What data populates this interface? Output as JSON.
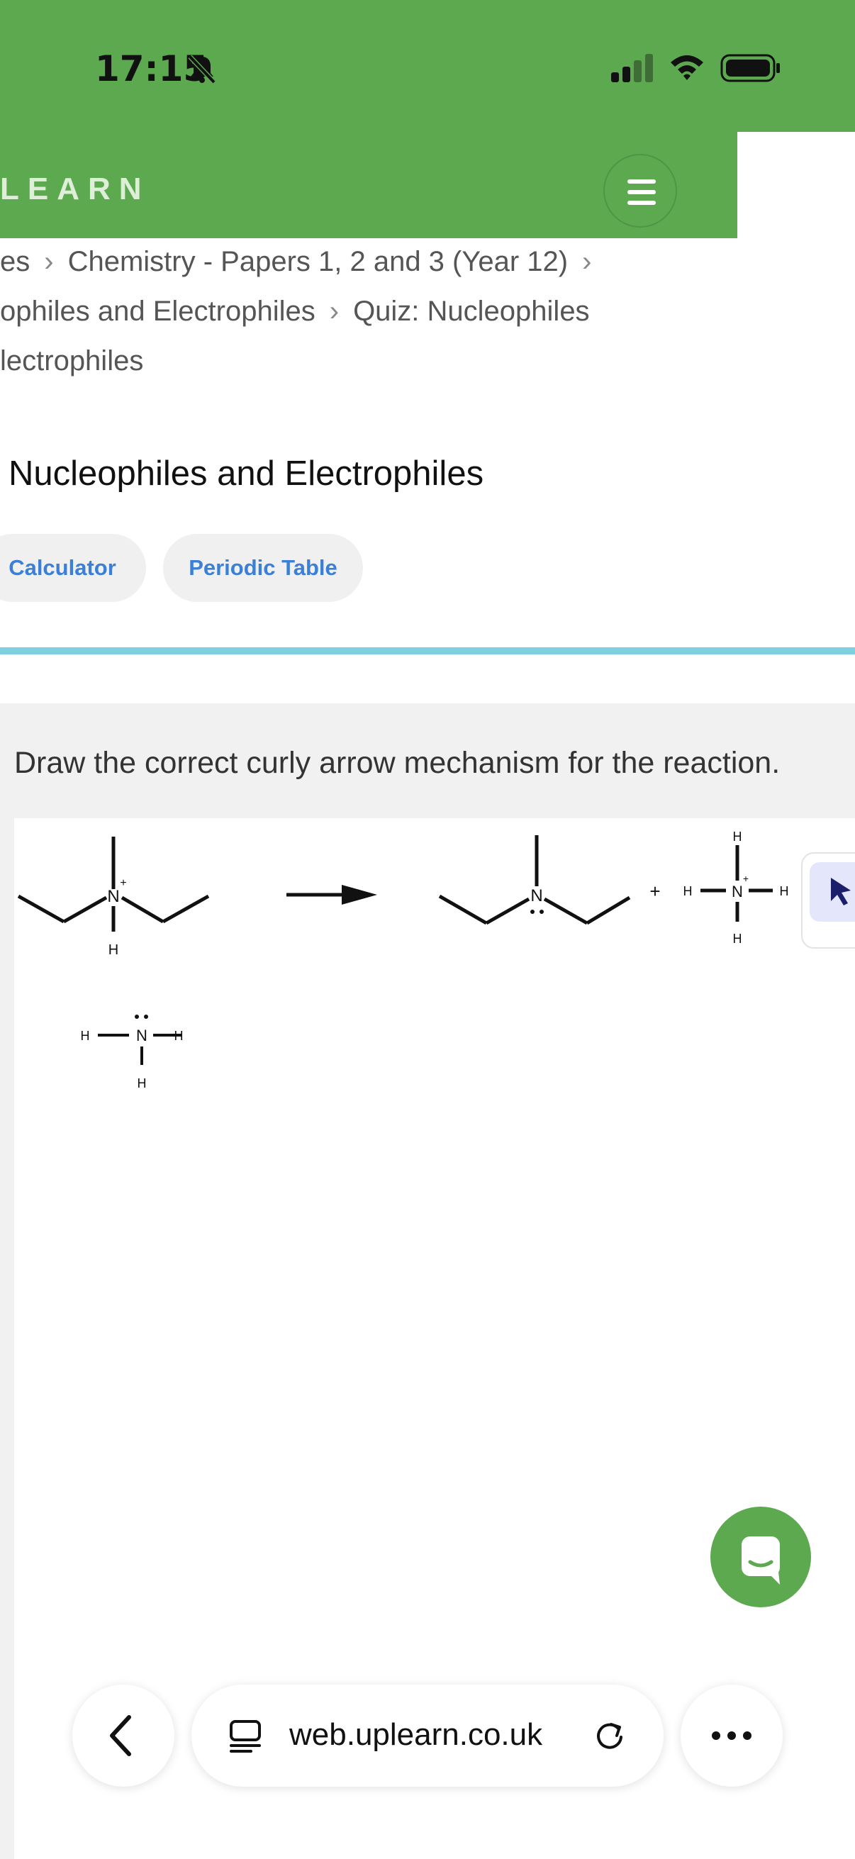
{
  "status_bar": {
    "time": "17:15",
    "icons": [
      "bell-slash-icon",
      "signal-icon",
      "wifi-icon",
      "battery-icon"
    ]
  },
  "header": {
    "logo_text": "LEARN",
    "menu_icon": "hamburger-icon"
  },
  "breadcrumb": {
    "items": [
      "es",
      "Chemistry - Papers 1, 2 and 3 (Year 12)",
      "ophiles and Electrophiles",
      "Quiz: Nucleophiles",
      "lectrophiles"
    ]
  },
  "page": {
    "title": "Nucleophiles and Electrophiles",
    "buttons": [
      "Calculator",
      "Periodic Table"
    ]
  },
  "question": {
    "prompt": "Draw the correct curly arrow mechanism for the reaction.",
    "reaction": {
      "reactant_atoms": {
        "N_plus": "N",
        "plus": "+",
        "H": "H"
      },
      "nucleophile_atoms": {
        "N": "N",
        "H": "H"
      },
      "product_amine": {
        "N": "N"
      },
      "plus_sign": "+",
      "ammonium": {
        "N": "N",
        "plus": "+",
        "H": "H"
      }
    },
    "tool_icon": "cursor-arrow-icon"
  },
  "chat": {
    "icon": "chat-bubble-icon"
  },
  "browser": {
    "url": "web.uplearn.co.uk",
    "back_icon": "chevron-left-icon",
    "tabs_icon": "tab-icon",
    "reload_icon": "reload-icon",
    "more_icon": "more-dots-icon"
  },
  "colors": {
    "brand_green": "#5ca94f",
    "accent_blue": "#3b7fd6",
    "divider_cyan": "#7fd0de"
  }
}
